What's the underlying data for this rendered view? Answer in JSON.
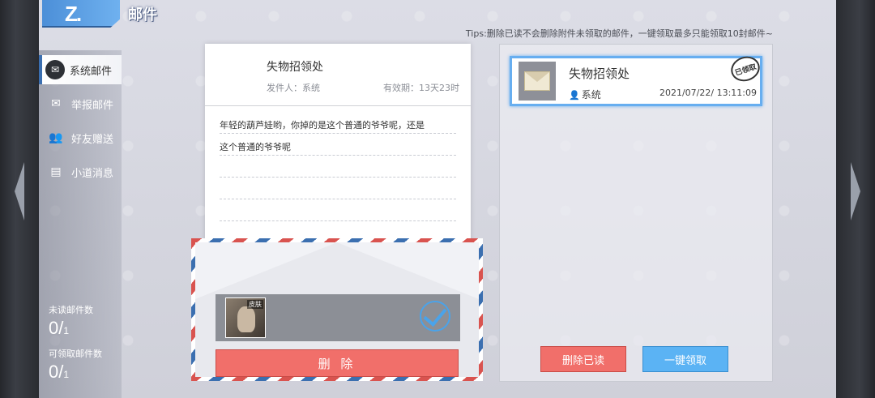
{
  "header": {
    "back_glyph": "Z.",
    "title": "邮件",
    "tips": "Tips:删除已读不会删除附件未领取的邮件，一键领取最多只能领取10封邮件~"
  },
  "sidebar": {
    "items": [
      {
        "label": "系统邮件",
        "icon": "envelope-icon",
        "active": true
      },
      {
        "label": "举报邮件",
        "icon": "report-mail-icon",
        "active": false
      },
      {
        "label": "好友赠送",
        "icon": "friends-icon",
        "active": false
      },
      {
        "label": "小道消息",
        "icon": "news-icon",
        "active": false
      }
    ],
    "unread_label": "未读邮件数",
    "unread_value": "0/",
    "unread_total": "1",
    "claimable_label": "可领取邮件数",
    "claimable_value": "0/",
    "claimable_total": "1"
  },
  "letter": {
    "title": "失物招领处",
    "sender": "发件人：系统",
    "validity": "有效期：13天23时",
    "lines": [
      "年轻的葫芦娃哟，你掉的是这个普通的爷爷呢，还是",
      "这个普通的爷爷呢",
      "",
      "",
      "",
      ""
    ],
    "attachment_tag": "皮肤",
    "delete_label": "删 除"
  },
  "mail_list": [
    {
      "title": "失物招领处",
      "sender": "系统",
      "date": "2021/07/22/ 13:11:09",
      "status": "已领取"
    }
  ],
  "actions": {
    "delete_read": "删除已读",
    "claim_all": "一键领取"
  },
  "colors": {
    "accent_blue": "#5bb3f4",
    "accent_red": "#f16f6a",
    "selection": "#67aef0"
  }
}
